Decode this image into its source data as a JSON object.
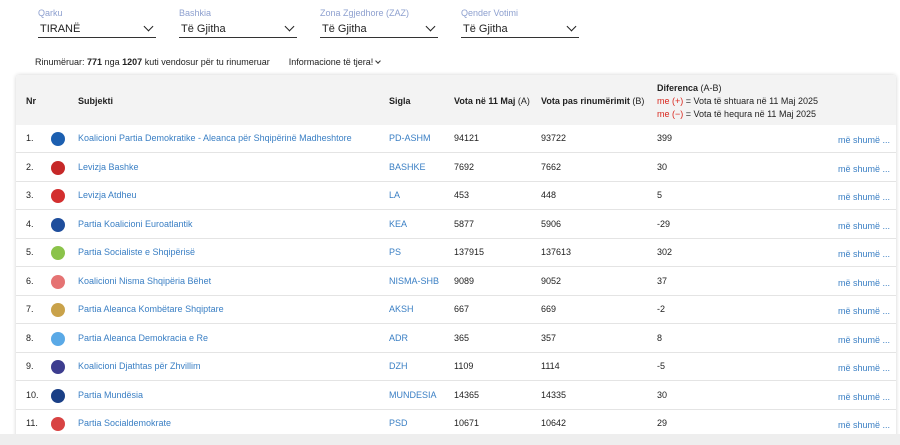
{
  "filters": [
    {
      "label": "Qarku",
      "value": "TIRANË"
    },
    {
      "label": "Bashkia",
      "value": "Të Gjitha"
    },
    {
      "label": "Zona Zgjedhore (ZAZ)",
      "value": "Të Gjitha"
    },
    {
      "label": "Qender Votimi",
      "value": "Të Gjitha"
    }
  ],
  "info": {
    "prefix": "Rinumëruar:",
    "count": "771",
    "mid": "nga",
    "total": "1207",
    "suffix": "kuti vendosur për tu rinumeruar",
    "more_info": "Informacione të tjera!"
  },
  "table": {
    "headers": {
      "nr": "Nr",
      "subject": "Subjekti",
      "acronym": "Sigla",
      "votes_a": "Vota në 11 Maj",
      "votes_a_tag": "(A)",
      "votes_b": "Vota pas rinumërimit",
      "votes_b_tag": "(B)",
      "diff": "Diferenca",
      "diff_tag": "(A-B)",
      "note1_prefix": "me (+)",
      "note1_text": "= Vota të shtuara në 11 Maj 2025",
      "note2_prefix": "me (−)",
      "note2_text": "= Vota të hequra në 11 Maj 2025"
    },
    "more_label": "më shumë ...",
    "rows": [
      {
        "nr": "1.",
        "subject": "Koalicioni Partia Demokratike - Aleanca për Shqipërinë Madheshtore",
        "acronym": "PD-ASHM",
        "a": "94121",
        "b": "93722",
        "diff": "399",
        "logo_color": "#1c5fb0"
      },
      {
        "nr": "2.",
        "subject": "Levizja Bashke",
        "acronym": "BASHKE",
        "a": "7692",
        "b": "7662",
        "diff": "30",
        "logo_color": "#c62828"
      },
      {
        "nr": "3.",
        "subject": "Levizja Atdheu",
        "acronym": "LA",
        "a": "453",
        "b": "448",
        "diff": "5",
        "logo_color": "#d32f2f"
      },
      {
        "nr": "4.",
        "subject": "Partia Koalicioni Euroatlantik",
        "acronym": "KEA",
        "a": "5877",
        "b": "5906",
        "diff": "-29",
        "logo_color": "#1f4e9c"
      },
      {
        "nr": "5.",
        "subject": "Partia Socialiste e Shqipërisë",
        "acronym": "PS",
        "a": "137915",
        "b": "137613",
        "diff": "302",
        "logo_color": "#8bc34a"
      },
      {
        "nr": "6.",
        "subject": "Koalicioni Nisma Shqipëria Bëhet",
        "acronym": "NISMA-SHB",
        "a": "9089",
        "b": "9052",
        "diff": "37",
        "logo_color": "#e57373"
      },
      {
        "nr": "7.",
        "subject": "Partia Aleanca Kombëtare Shqiptare",
        "acronym": "AKSH",
        "a": "667",
        "b": "669",
        "diff": "-2",
        "logo_color": "#c9a24a"
      },
      {
        "nr": "8.",
        "subject": "Partia Aleanca Demokracia e Re",
        "acronym": "ADR",
        "a": "365",
        "b": "357",
        "diff": "8",
        "logo_color": "#5aa9e6"
      },
      {
        "nr": "9.",
        "subject": "Koalicioni Djathtas për Zhvillim",
        "acronym": "DZH",
        "a": "1109",
        "b": "1114",
        "diff": "-5",
        "logo_color": "#3d3d8f"
      },
      {
        "nr": "10.",
        "subject": "Partia Mundësia",
        "acronym": "MUNDESIA",
        "a": "14365",
        "b": "14335",
        "diff": "30",
        "logo_color": "#1a3f86"
      },
      {
        "nr": "11.",
        "subject": "Partia Socialdemokrate",
        "acronym": "PSD",
        "a": "10671",
        "b": "10642",
        "diff": "29",
        "logo_color": "#d84343"
      }
    ]
  }
}
